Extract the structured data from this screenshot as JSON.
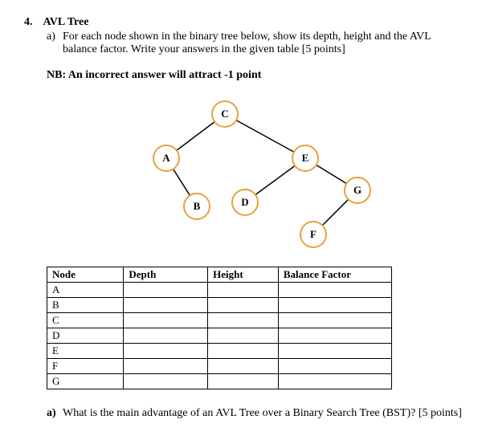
{
  "question": {
    "number": "4.",
    "title": "AVL Tree",
    "part_a_letter": "a)",
    "part_a_text": "For each node shown in the binary tree below, show its depth, height and the AVL balance factor. Write your answers in the given table [5 points]",
    "nb": "NB: An incorrect answer will attract -1 point",
    "part_b_letter": "a)",
    "part_b_text": "What is the main advantage of an AVL Tree over a Binary Search Tree (BST)? [5 points]"
  },
  "tree": {
    "nodes": {
      "C": "C",
      "A": "A",
      "E": "E",
      "B": "B",
      "D": "D",
      "G": "G",
      "F": "F"
    }
  },
  "table": {
    "headers": {
      "node": "Node",
      "depth": "Depth",
      "height": "Height",
      "bf": "Balance Factor"
    },
    "rows": [
      "A",
      "B",
      "C",
      "D",
      "E",
      "F",
      "G"
    ]
  },
  "chart_data": {
    "type": "table",
    "title": "AVL Tree node depth, height and balance factor",
    "columns": [
      "Node",
      "Depth",
      "Height",
      "Balance Factor"
    ],
    "rows": [
      {
        "Node": "A",
        "Depth": "",
        "Height": "",
        "Balance Factor": ""
      },
      {
        "Node": "B",
        "Depth": "",
        "Height": "",
        "Balance Factor": ""
      },
      {
        "Node": "C",
        "Depth": "",
        "Height": "",
        "Balance Factor": ""
      },
      {
        "Node": "D",
        "Depth": "",
        "Height": "",
        "Balance Factor": ""
      },
      {
        "Node": "E",
        "Depth": "",
        "Height": "",
        "Balance Factor": ""
      },
      {
        "Node": "F",
        "Depth": "",
        "Height": "",
        "Balance Factor": ""
      },
      {
        "Node": "G",
        "Depth": "",
        "Height": "",
        "Balance Factor": ""
      }
    ],
    "tree_structure": {
      "root": "C",
      "edges": [
        [
          "C",
          "A"
        ],
        [
          "C",
          "E"
        ],
        [
          "A",
          "B"
        ],
        [
          "E",
          "D"
        ],
        [
          "E",
          "G"
        ],
        [
          "G",
          "F"
        ]
      ]
    }
  }
}
